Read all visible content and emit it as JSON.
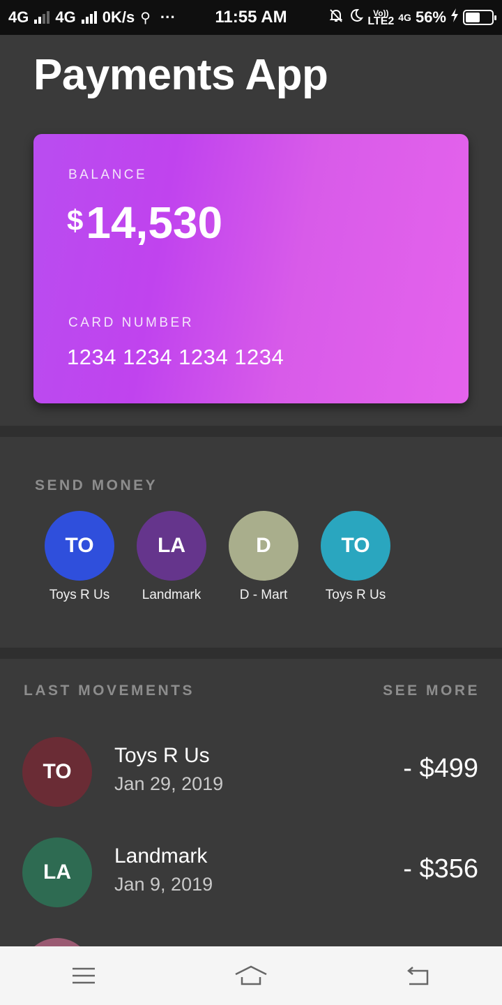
{
  "status_bar": {
    "network1": "4G",
    "network2": "4G",
    "speed": "0K/s",
    "time": "11:55 AM",
    "volte": "Vo))",
    "lte": "LTE2",
    "net3": "4G",
    "battery": "56%",
    "battery_level": 0.56
  },
  "header": {
    "title": "Payments App"
  },
  "card": {
    "balance_label": "BALANCE",
    "currency": "$",
    "balance": "14,530",
    "number_label": "CARD NUMBER",
    "number": "1234 1234 1234 1234",
    "gradient_start": "#b94df0",
    "gradient_end": "#e563ec"
  },
  "send_money": {
    "label": "SEND MONEY",
    "contacts": [
      {
        "initials": "TO",
        "name": "Toys R Us",
        "color": "#2f4fdc"
      },
      {
        "initials": "LA",
        "name": "Landmark",
        "color": "#65358c"
      },
      {
        "initials": "D",
        "name": "D - Mart",
        "color": "#a9ae8c"
      },
      {
        "initials": "TO",
        "name": "Toys R Us",
        "color": "#2aa6bf"
      }
    ]
  },
  "movements": {
    "label": "LAST MOVEMENTS",
    "see_more": "SEE MORE",
    "items": [
      {
        "initials": "TO",
        "name": "Toys R Us",
        "date": "Jan 29, 2019",
        "amount": "- $499",
        "color": "#6a2c35"
      },
      {
        "initials": "LA",
        "name": "Landmark",
        "date": "Jan 9, 2019",
        "amount": "- $356",
        "color": "#2e6b52"
      }
    ]
  },
  "nav": {
    "icons": [
      "menu-icon",
      "home-icon",
      "back-icon"
    ]
  }
}
